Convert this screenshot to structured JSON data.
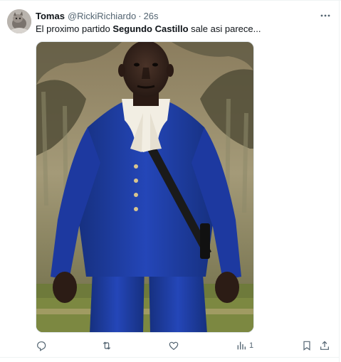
{
  "post": {
    "author_name": "Tomas",
    "author_handle": "@RickiRichiardo",
    "separator": "·",
    "timestamp": "26s",
    "text_before": "El proximo partido ",
    "text_bold": "Segundo Castillo",
    "text_after": " sale asi parece..."
  },
  "actions": {
    "views_count": "1"
  },
  "icons": {
    "more": "more-horizontal-icon",
    "reply": "reply-icon",
    "retweet": "retweet-icon",
    "like": "heart-icon",
    "views": "views-chart-icon",
    "bookmark": "bookmark-icon",
    "share": "share-icon"
  },
  "colors": {
    "text_primary": "#0f1419",
    "text_secondary": "#536471",
    "border": "#eff3f4",
    "coat_blue": "#1f3fae"
  }
}
